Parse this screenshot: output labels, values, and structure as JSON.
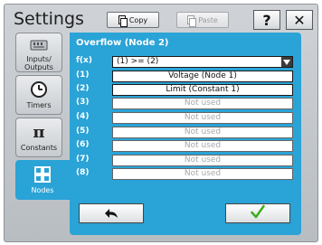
{
  "header": {
    "title": "Settings",
    "copy_label": "Copy",
    "paste_label": "Paste",
    "help_label": "?",
    "close_label": "✕"
  },
  "sidebar": {
    "items": [
      {
        "label_line1": "Inputs/",
        "label_line2": "Outputs",
        "icon": "io-module-icon",
        "active": false
      },
      {
        "label": "Timers",
        "icon": "clock-icon",
        "active": false
      },
      {
        "label": "Constants",
        "icon": "pi-icon",
        "active": false
      },
      {
        "label": "Nodes",
        "icon": "grid-icon",
        "active": true
      }
    ]
  },
  "panel": {
    "title": "Overflow (Node 2)",
    "function_label": "f(x)",
    "function_value": "(1) >= (2)",
    "rows": [
      {
        "label": "(1)",
        "value": "Voltage (Node 1)",
        "used": true
      },
      {
        "label": "(2)",
        "value": "Limit (Constant 1)",
        "used": true
      },
      {
        "label": "(3)",
        "value": "Not used",
        "used": false
      },
      {
        "label": "(4)",
        "value": "Not used",
        "used": false
      },
      {
        "label": "(5)",
        "value": "Not used",
        "used": false
      },
      {
        "label": "(6)",
        "value": "Not used",
        "used": false
      },
      {
        "label": "(7)",
        "value": "Not used",
        "used": false
      },
      {
        "label": "(8)",
        "value": "Not used",
        "used": false
      }
    ]
  },
  "footer": {
    "back_icon": "back-arrow-icon",
    "confirm_icon": "checkmark-icon"
  },
  "colors": {
    "accent": "#2aa3d6",
    "confirm": "#3cae1e"
  }
}
